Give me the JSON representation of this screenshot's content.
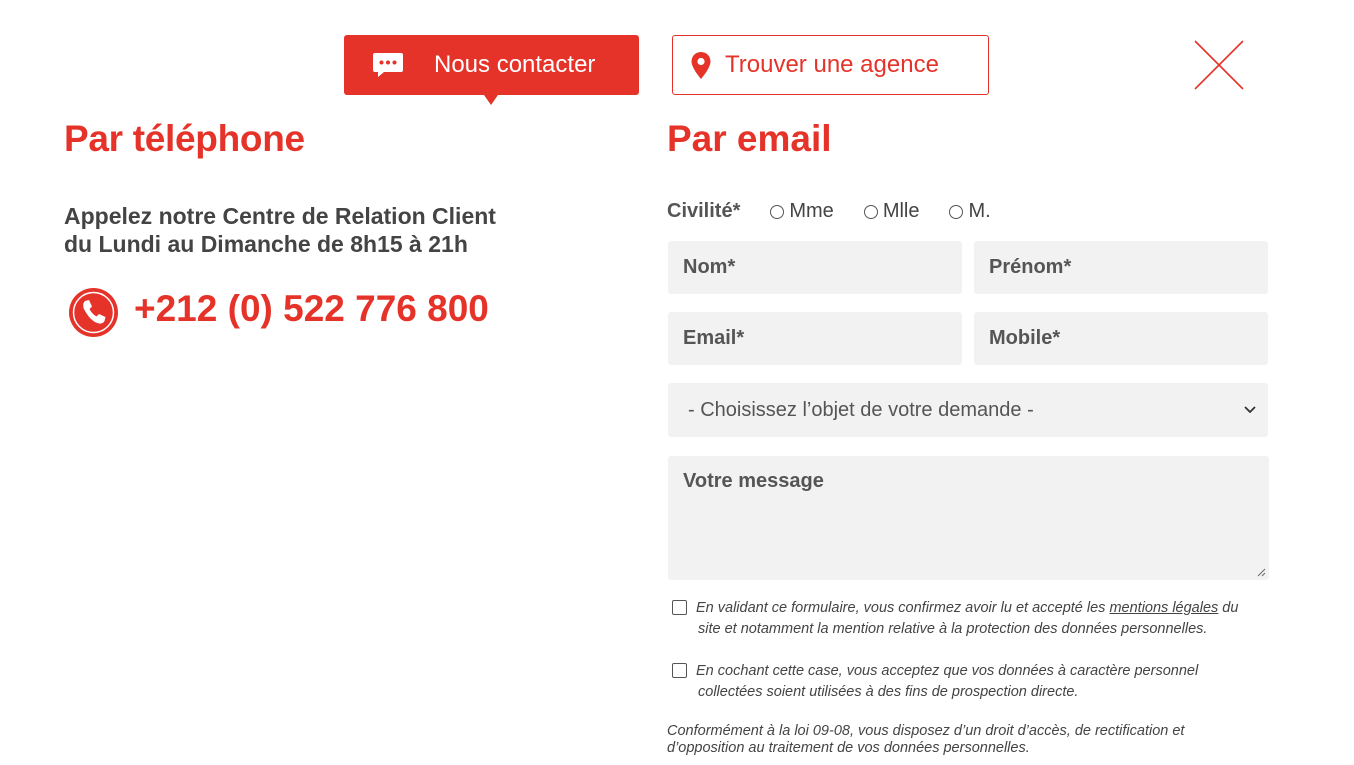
{
  "tabs": {
    "contact_label": "Nous contacter",
    "agency_label": "Trouver une agence"
  },
  "colors": {
    "accent": "#e5332a",
    "field_bg": "#f2f2f2",
    "text": "#444444"
  },
  "icons": {
    "contact": "chat-bubble-icon",
    "agency": "map-pin-icon",
    "close": "close-icon",
    "phone": "phone-icon"
  },
  "phone_section": {
    "title": "Par téléphone",
    "line1": "Appelez notre Centre de Relation Client",
    "line2": "du Lundi au Dimanche de 8h15 à 21h",
    "number": "+212 (0) 522 776 800"
  },
  "email_section": {
    "title": "Par email",
    "civility_label": "Civilité*",
    "civility_options": [
      "Mme",
      "Mlle",
      "M."
    ],
    "nom_placeholder": "Nom*",
    "prenom_placeholder": "Prénom*",
    "email_placeholder": "Email*",
    "mobile_placeholder": "Mobile*",
    "subject_selected": "- Choisissez l’objet de votre demande -",
    "message_placeholder": "Votre message",
    "consent1_before": "En validant ce formulaire, vous confirmez avoir lu et accepté les ",
    "consent1_link": "mentions légales",
    "consent1_after": " du",
    "consent1_line2": "site et notamment la mention relative à la protection des données personnelles.",
    "consent2_line1": "En cochant cette case, vous acceptez que vos données à caractère personnel",
    "consent2_line2": "collectées soient utilisées à des fins de prospection directe.",
    "legal_line1": "Conformément à la loi 09-08, vous disposez d’un droit d’accès, de rectification et",
    "legal_line2": "d’opposition au traitement de vos données personnelles."
  }
}
